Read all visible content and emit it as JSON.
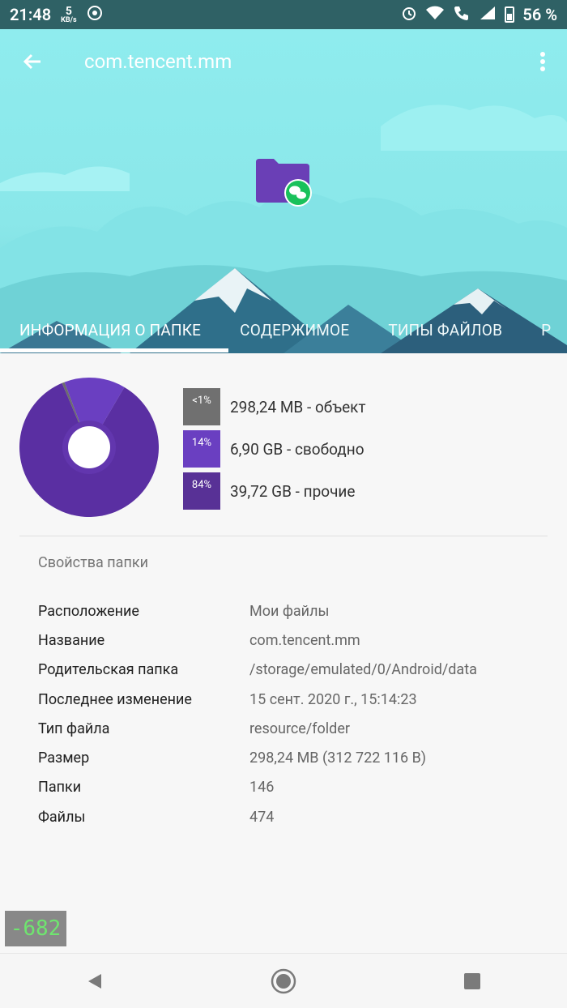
{
  "status_bar": {
    "time": "21:48",
    "net_speed_value": "5",
    "net_speed_unit": "KB/s",
    "battery": "56 %",
    "icons": [
      "sync-icon",
      "alarm-icon",
      "wifi-icon",
      "call-icon",
      "signal-icon",
      "battery-icon"
    ]
  },
  "header": {
    "title": "com.tencent.mm",
    "back_icon": "back-arrow-icon",
    "more_icon": "more-vert-icon"
  },
  "tabs": [
    {
      "label": "ИНФОРМАЦИЯ О ПАПКЕ",
      "active": true
    },
    {
      "label": "СОДЕРЖИМОЕ",
      "active": false
    },
    {
      "label": "ТИПЫ ФАЙЛОВ",
      "active": false
    },
    {
      "label": "Р",
      "active": false
    }
  ],
  "storage": {
    "legend": [
      {
        "pct": "<1%",
        "text": "298,24 MB - объект",
        "color": "#707070"
      },
      {
        "pct": "14%",
        "text": "6,90 GB - свободно",
        "color": "#6a3fc1"
      },
      {
        "pct": "84%",
        "text": "39,72 GB - прочие",
        "color": "#583196"
      }
    ]
  },
  "chart_data": {
    "type": "pie",
    "categories": [
      "объект",
      "свободно",
      "прочие"
    ],
    "values": [
      0.6,
      14,
      84
    ],
    "colors": [
      "#6d6d6d",
      "#6a3fc1",
      "#5a2fa2"
    ]
  },
  "properties": {
    "title": "Свойства папки",
    "rows": [
      {
        "key": "Расположение",
        "value": "Мои файлы"
      },
      {
        "key": "Название",
        "value": "com.tencent.mm"
      },
      {
        "key": "Родительская папка",
        "value": "/storage/emulated/0/Android/data"
      },
      {
        "key": "Последнее изменение",
        "value": "15 сент. 2020 г., 15:14:23"
      },
      {
        "key": "Тип файла",
        "value": "resource/folder"
      },
      {
        "key": "Размер",
        "value": "298,24 MB (312 722 116 B)"
      },
      {
        "key": "Папки",
        "value": "146"
      },
      {
        "key": "Файлы",
        "value": "474"
      }
    ]
  },
  "debug_badge": "-682",
  "nav_bar": {
    "icons": [
      "nav-back-icon",
      "nav-home-icon",
      "nav-recents-icon"
    ]
  }
}
